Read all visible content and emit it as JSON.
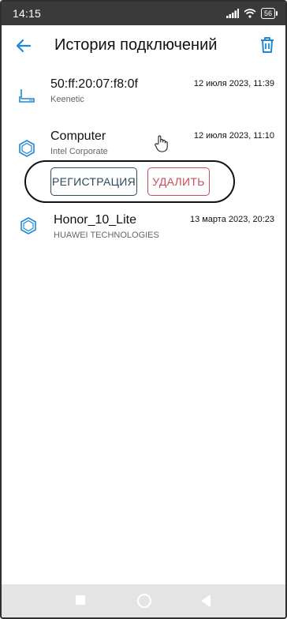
{
  "status_bar": {
    "time": "14:15",
    "battery": "56"
  },
  "app_bar": {
    "title": "История подключений"
  },
  "devices": [
    {
      "name": "50:ff:20:07:f8:0f",
      "vendor": "Keenetic",
      "date": "12 июля 2023, 11:39",
      "icon": "router-icon"
    },
    {
      "name": "Computer",
      "vendor": "Intel Corporate",
      "date": "12 июля 2023, 11:10",
      "icon": "hexagon-device-icon"
    },
    {
      "name": "Honor_10_Lite",
      "vendor": "HUAWEI TECHNOLOGIES",
      "date": "13 марта 2023, 20:23",
      "icon": "hexagon-device-icon"
    }
  ],
  "actions": {
    "register_label": "РЕГИСТРАЦИЯ",
    "delete_label": "УДАЛИТЬ"
  },
  "colors": {
    "accent": "#1e88d6",
    "register": "#2d4a5b",
    "delete": "#cc4a5a"
  }
}
